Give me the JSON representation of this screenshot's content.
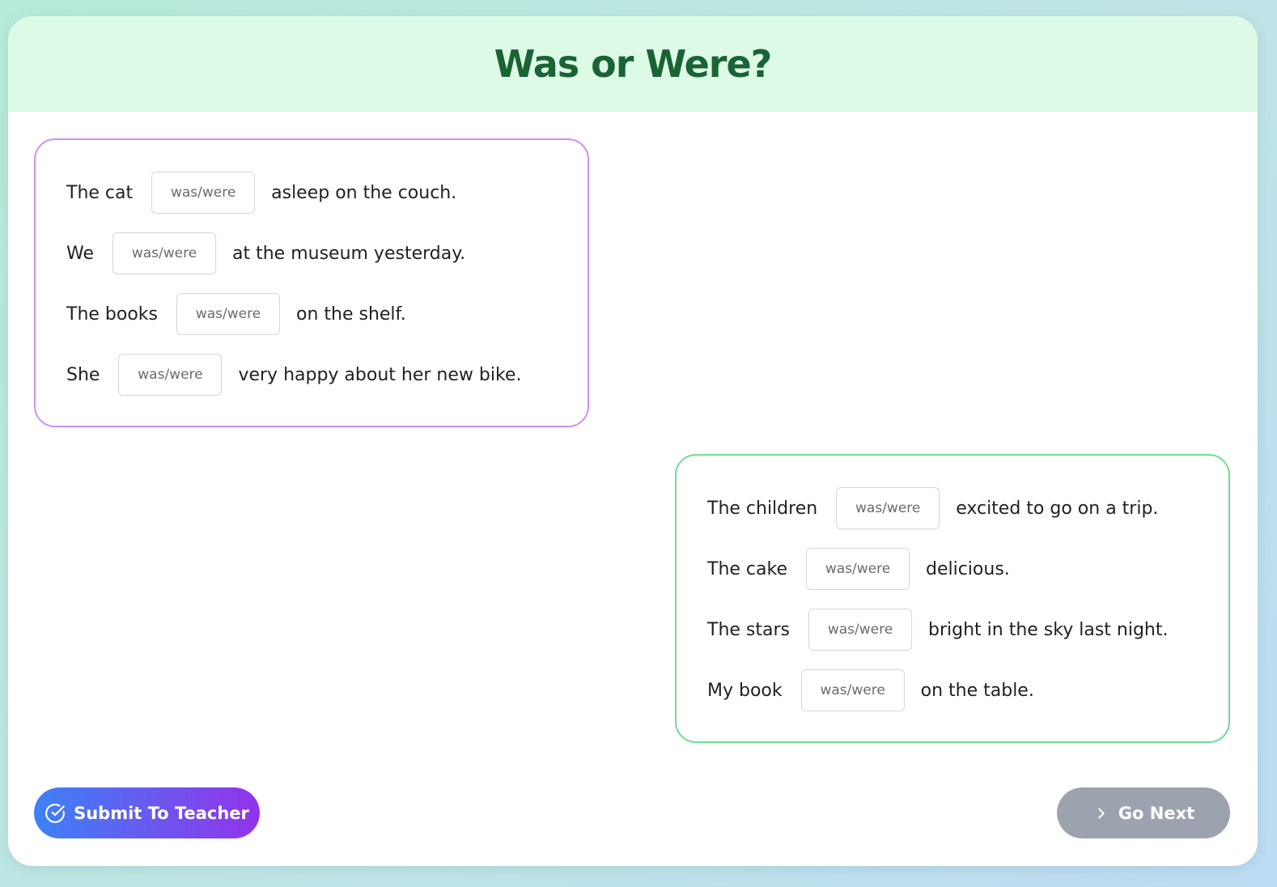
{
  "title": "Was or Were?",
  "placeholder": "was/were",
  "panel_a": {
    "rows": [
      {
        "before": "The cat",
        "after": "asleep on the couch."
      },
      {
        "before": "We",
        "after": "at the museum yesterday."
      },
      {
        "before": "The books",
        "after": "on the shelf."
      },
      {
        "before": "She",
        "after": "very happy about her new bike."
      }
    ]
  },
  "panel_b": {
    "rows": [
      {
        "before": "The children",
        "after": "excited to go on a trip."
      },
      {
        "before": "The cake",
        "after": "delicious."
      },
      {
        "before": "The stars",
        "after": "bright in the sky last night."
      },
      {
        "before": "My book",
        "after": "on the table."
      }
    ]
  },
  "buttons": {
    "submit_label": "Submit To Teacher",
    "submit_icon": "check-circle-icon",
    "next_label": "Go Next",
    "next_icon": "chevron-right-icon"
  },
  "colors": {
    "header_bg": "#dcfae6",
    "title": "#1a6334",
    "panel_a_border": "#cf8ff3",
    "panel_b_border": "#6fdc93",
    "submit_gradient_start": "#3c82f6",
    "submit_gradient_end": "#9333ea",
    "next_bg": "#9ca3af"
  }
}
